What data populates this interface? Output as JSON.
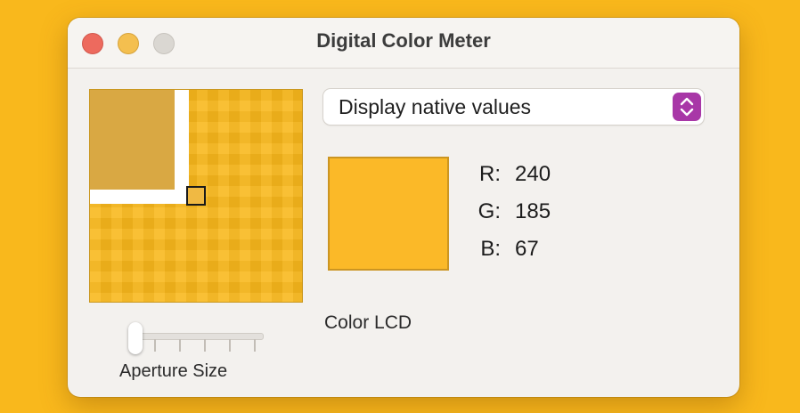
{
  "window": {
    "title": "Digital Color Meter",
    "controls": [
      "close",
      "minimize",
      "zoom"
    ]
  },
  "mode_dropdown": {
    "selected": "Display native values"
  },
  "color": {
    "swatch_hex": "#fbb928",
    "r_label": "R:",
    "r_value": "240",
    "g_label": "G:",
    "g_value": "185",
    "b_label": "B:",
    "b_value": "67"
  },
  "display": {
    "name": "Color LCD"
  },
  "aperture": {
    "label": "Aperture Size",
    "level": 0
  },
  "colors": {
    "desktop": "#f9b81c",
    "stepper_accent": "#a837a7",
    "close": "#ed6a5e",
    "minimize": "#f4bf4f",
    "zoom_disabled": "#dad7d2"
  },
  "icons": {
    "stepper": "chevron-up-down-icon"
  }
}
